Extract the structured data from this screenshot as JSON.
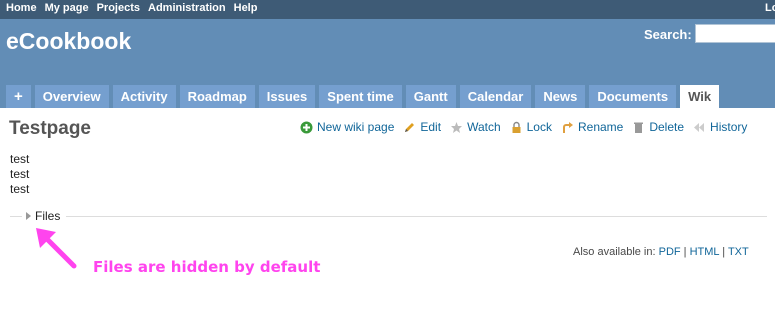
{
  "top_menu": {
    "items": [
      {
        "label": "Home"
      },
      {
        "label": "My page"
      },
      {
        "label": "Projects"
      },
      {
        "label": "Administration"
      },
      {
        "label": "Help"
      }
    ],
    "right_label": "Lo"
  },
  "header": {
    "title": "eCookbook",
    "search_label": "Search:",
    "search_value": ""
  },
  "tabs": [
    {
      "label": "+",
      "name": "tab-new"
    },
    {
      "label": "Overview",
      "name": "tab-overview"
    },
    {
      "label": "Activity",
      "name": "tab-activity"
    },
    {
      "label": "Roadmap",
      "name": "tab-roadmap"
    },
    {
      "label": "Issues",
      "name": "tab-issues"
    },
    {
      "label": "Spent time",
      "name": "tab-spent-time"
    },
    {
      "label": "Gantt",
      "name": "tab-gantt"
    },
    {
      "label": "Calendar",
      "name": "tab-calendar"
    },
    {
      "label": "News",
      "name": "tab-news"
    },
    {
      "label": "Documents",
      "name": "tab-documents"
    },
    {
      "label": "Wik",
      "name": "tab-wiki",
      "selected": true
    }
  ],
  "page": {
    "title": "Testpage",
    "contextual": [
      {
        "label": "New wiki page",
        "icon": "add-icon",
        "color": "#3a9a3a"
      },
      {
        "label": "Edit",
        "icon": "pencil-icon",
        "color": "#e0a020"
      },
      {
        "label": "Watch",
        "icon": "star-icon",
        "color": "#bbbbbb"
      },
      {
        "label": "Lock",
        "icon": "lock-icon",
        "color": "#d9a030"
      },
      {
        "label": "Rename",
        "icon": "rename-arrow-icon",
        "color": "#e0a040"
      },
      {
        "label": "Delete",
        "icon": "trash-icon",
        "color": "#999999"
      },
      {
        "label": "History",
        "icon": "history-icon",
        "color": "#cccccc"
      }
    ],
    "content_lines": [
      "test",
      "test",
      "test"
    ],
    "files_label": "Files"
  },
  "other_formats": {
    "label": "Also available in:",
    "links": [
      "PDF",
      "HTML",
      "TXT"
    ]
  },
  "annotation": {
    "text": "Files are hidden by default",
    "color": "#ff44ee"
  }
}
